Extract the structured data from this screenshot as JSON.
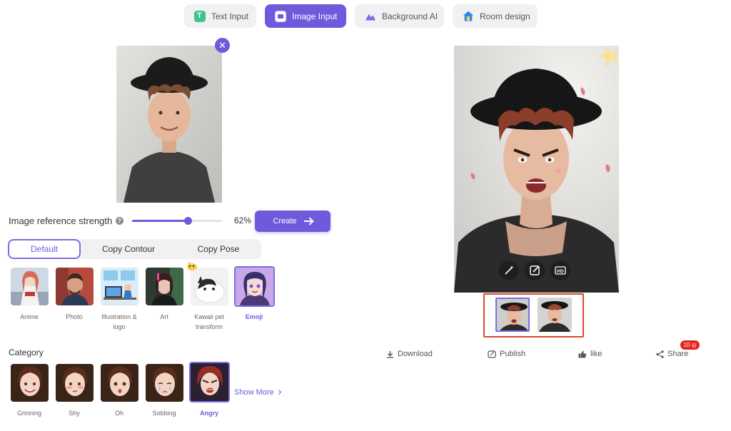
{
  "tabs": [
    {
      "label": "Text Input",
      "icon": "text-icon",
      "active": false
    },
    {
      "label": "Image Input",
      "icon": "image-icon",
      "active": true
    },
    {
      "label": "Background AI",
      "icon": "mountain-icon",
      "active": false
    },
    {
      "label": "Room design",
      "icon": "house-icon",
      "active": false
    }
  ],
  "strength": {
    "label": "Image reference strength",
    "value_text": "62%",
    "percent": 62
  },
  "create": {
    "label": "Create"
  },
  "modes": [
    {
      "label": "Default",
      "active": true
    },
    {
      "label": "Copy Contour",
      "active": false
    },
    {
      "label": "Copy Pose",
      "active": false
    }
  ],
  "styles": [
    {
      "label": "Anime",
      "selected": false
    },
    {
      "label": "Photo",
      "selected": false
    },
    {
      "label": "Illustration & logo",
      "selected": false
    },
    {
      "label": "Art",
      "selected": false
    },
    {
      "label": "Kawaii pet transform",
      "selected": false
    },
    {
      "label": "Emoji",
      "selected": true
    }
  ],
  "category": {
    "title": "Category",
    "items": [
      {
        "label": "Grinning",
        "selected": false
      },
      {
        "label": "Shy",
        "selected": false
      },
      {
        "label": "Oh",
        "selected": false
      },
      {
        "label": "Sobbing",
        "selected": false
      },
      {
        "label": "Angry",
        "selected": true
      }
    ],
    "show_more": "Show More"
  },
  "output_tools": [
    "magic-wand-icon",
    "edit-icon",
    "hd-icon"
  ],
  "output_tool_hd": "HD",
  "actions": {
    "download": "Download",
    "publish": "Publish",
    "like": "like",
    "share": "Share",
    "share_badge": "10 ◎"
  },
  "colors": {
    "accent": "#6e5bdc",
    "highlight_border": "#e0452f",
    "badge": "#e5251d"
  }
}
